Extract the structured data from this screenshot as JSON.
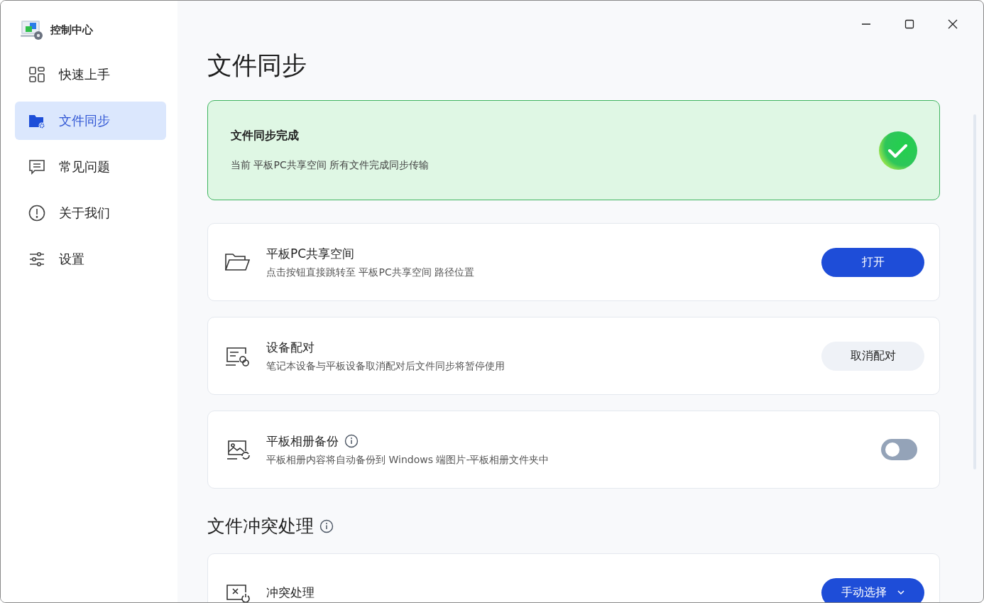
{
  "window": {
    "title": "控制中心"
  },
  "sidebar": {
    "items": [
      {
        "label": "快速上手",
        "selected": false
      },
      {
        "label": "文件同步",
        "selected": true
      },
      {
        "label": "常见问题",
        "selected": false
      },
      {
        "label": "关于我们",
        "selected": false
      },
      {
        "label": "设置",
        "selected": false
      }
    ]
  },
  "page": {
    "title": "文件同步"
  },
  "status_card": {
    "title": "文件同步完成",
    "message": "当前 平板PC共享空间 所有文件完成同步传输"
  },
  "cards": [
    {
      "kind": "button",
      "title": "平板PC共享空间",
      "info": false,
      "description": "点击按钮直接跳转至 平板PC共享空间 路径位置",
      "button": {
        "label": "打开",
        "primary": true
      }
    },
    {
      "kind": "button",
      "title": "设备配对",
      "info": false,
      "description": "笔记本设备与平板设备取消配对后文件同步将暂停使用",
      "button": {
        "label": "取消配对",
        "primary": false
      }
    },
    {
      "kind": "toggle",
      "title": "平板相册备份",
      "info": true,
      "description": "平板相册内容将自动备份到 Windows 端图片-平板相册文件夹中",
      "on": false
    }
  ],
  "section": {
    "title": "文件冲突处理",
    "info": true
  },
  "section_cards": [
    {
      "kind": "dropdown",
      "title": "冲突处理",
      "info": false,
      "button": {
        "label": "手动选择",
        "primary": true
      }
    }
  ]
}
